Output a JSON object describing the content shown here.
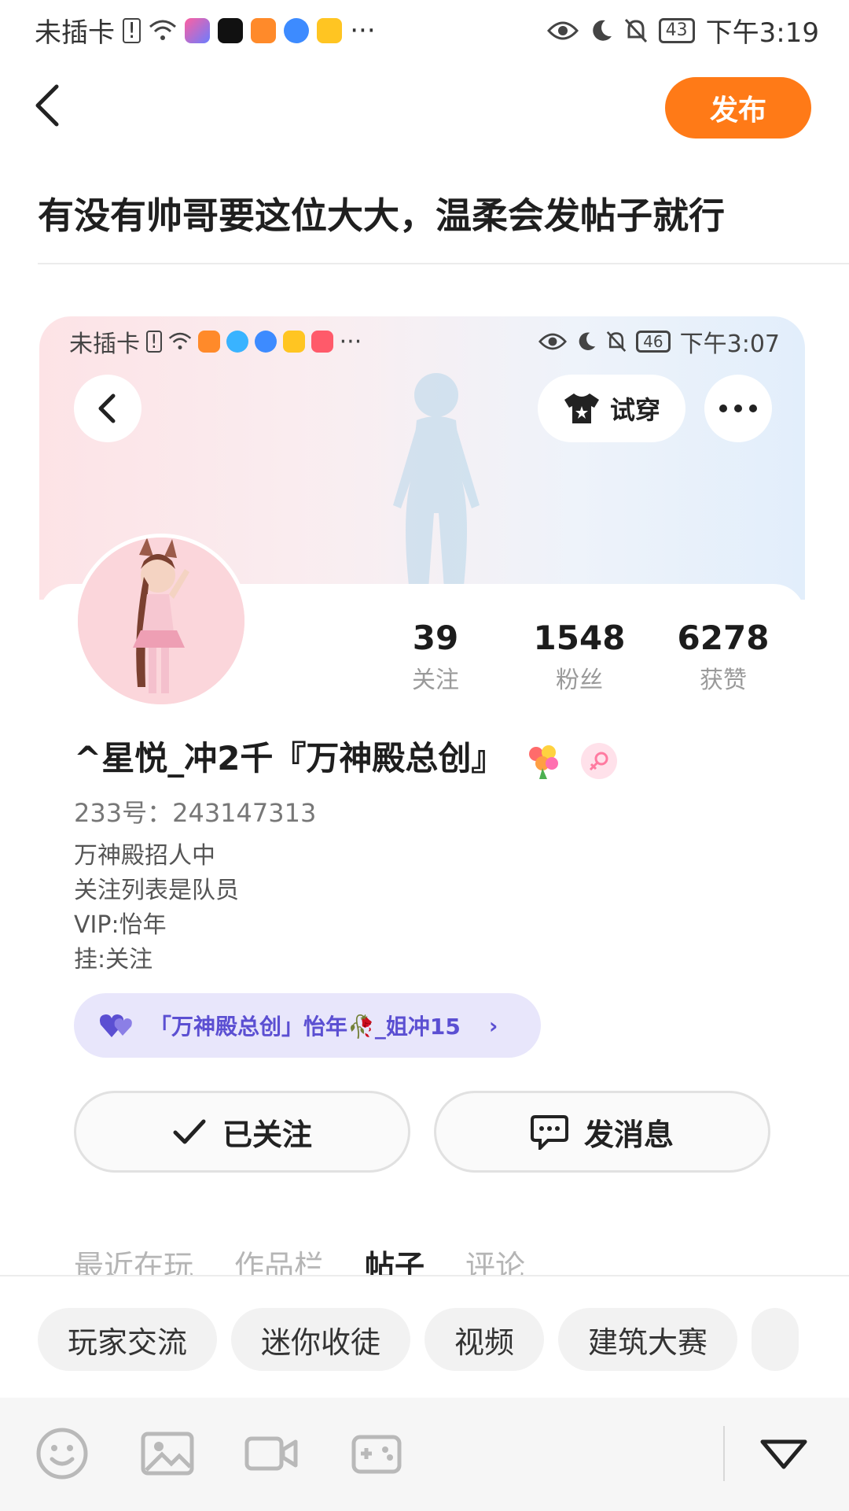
{
  "status_bar": {
    "carrier": "未插卡",
    "battery": "43",
    "time": "下午3:19",
    "more": "···"
  },
  "header": {
    "publish_label": "发布"
  },
  "post": {
    "title": "有没有帅哥要这位大大，温柔会发帖子就行"
  },
  "embedded": {
    "status_bar": {
      "carrier": "未插卡",
      "battery": "46",
      "time": "下午3:07",
      "more": "···"
    },
    "try_on_label": "试穿",
    "stats": [
      {
        "value": "39",
        "label": "关注"
      },
      {
        "value": "1548",
        "label": "粉丝"
      },
      {
        "value": "6278",
        "label": "获赞"
      }
    ],
    "username": "^星悦_冲2千『万神殿总创』",
    "user_id_label": "233号：",
    "user_id": "243147313",
    "bio": [
      "万神殿招人中",
      "关注列表是队员",
      "VIP:怡年",
      "挂:关注"
    ],
    "couple_label": "「万神殿总创」怡年🥀_姐冲15",
    "followed_label": "已关注",
    "message_label": "发消息",
    "tabs": [
      {
        "label": "最近在玩",
        "active": false
      },
      {
        "label": "作品栏",
        "active": false
      },
      {
        "label": "帖子",
        "active": true
      },
      {
        "label": "评论",
        "active": false
      }
    ]
  },
  "categories": [
    "玩家交流",
    "迷你收徒",
    "视频",
    "建筑大赛"
  ],
  "colors": {
    "accent": "#ff7a17",
    "pill_bg": "#e8e6fb",
    "pill_text": "#5b4fd2"
  },
  "toolbar_icons": [
    "emoji-icon",
    "image-icon",
    "video-icon",
    "game-icon",
    "collapse-icon"
  ]
}
